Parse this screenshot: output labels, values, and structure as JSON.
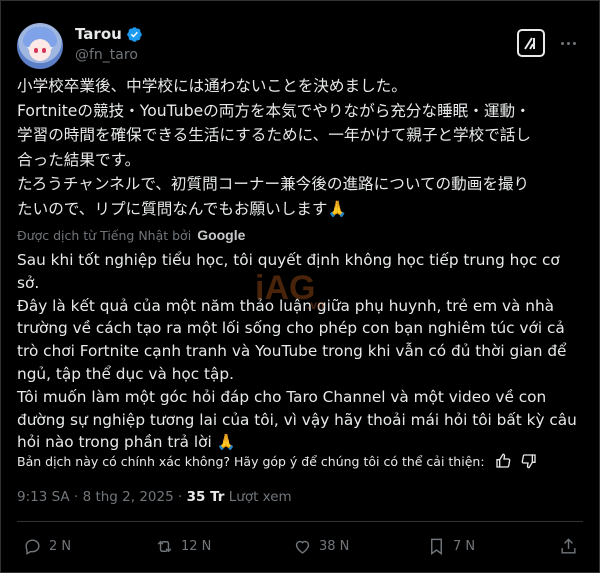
{
  "author": {
    "name": "Tarou",
    "handle": "@fn_taro"
  },
  "original_text": "小学校卒業後、中学校には通わないことを決めました。\nFortniteの競技・YouTubeの両方を本気でやりながら充分な睡眠・運動・\n学習の時間を確保できる生活にするために、一年かけて親子と学校で話し\n合った結果です。\nたろうチャンネルで、初質問コーナー兼今後の進路についての動画を撮り\nたいので、リプに質問なんでもお願いします🙏",
  "translation": {
    "label": "Được dịch từ Tiếng Nhật bởi",
    "provider": "Google",
    "text": "Sau khi tốt nghiệp tiểu học, tôi quyết định không học tiếp trung học cơ\nsở.\nĐây là kết quả của một năm thảo luận giữa phụ huynh, trẻ em và nhà\ntrường về cách tạo ra một lối sống cho phép con bạn nghiêm túc với cả\ntrò chơi Fortnite cạnh tranh và YouTube trong khi vẫn có đủ thời gian để\nngủ, tập thể dục và học tập.\nTôi muốn làm một góc hỏi đáp cho Taro Channel và một video về con\nđường sự nghiệp tương lai của tôi, vì vậy hãy thoải mái hỏi tôi bất kỳ câu\nhỏi nào trong phần trả lời 🙏"
  },
  "feedback_prompt": "Bản dịch này có chính xác không? Hãy góp ý để chúng tôi có thể cải thiện:",
  "meta": {
    "time": "9:13 SA",
    "sep": "·",
    "date": "8 thg 2, 2025",
    "views_count": "35 Tr",
    "views_label": "Lượt xem"
  },
  "actions": {
    "replies": "2 N",
    "reposts": "12 N",
    "likes": "38 N",
    "bookmarks": "7 N"
  },
  "icons": {
    "verified": "verified-badge-icon",
    "grok": "grok-icon",
    "more": "more-icon",
    "reply": "reply-icon",
    "repost": "repost-icon",
    "like": "heart-icon",
    "bookmark": "bookmark-icon",
    "share": "share-icon"
  },
  "colors": {
    "background": "#000000",
    "text": "#e7e9ea",
    "muted": "#71767b",
    "verified": "#1d9bf0"
  }
}
